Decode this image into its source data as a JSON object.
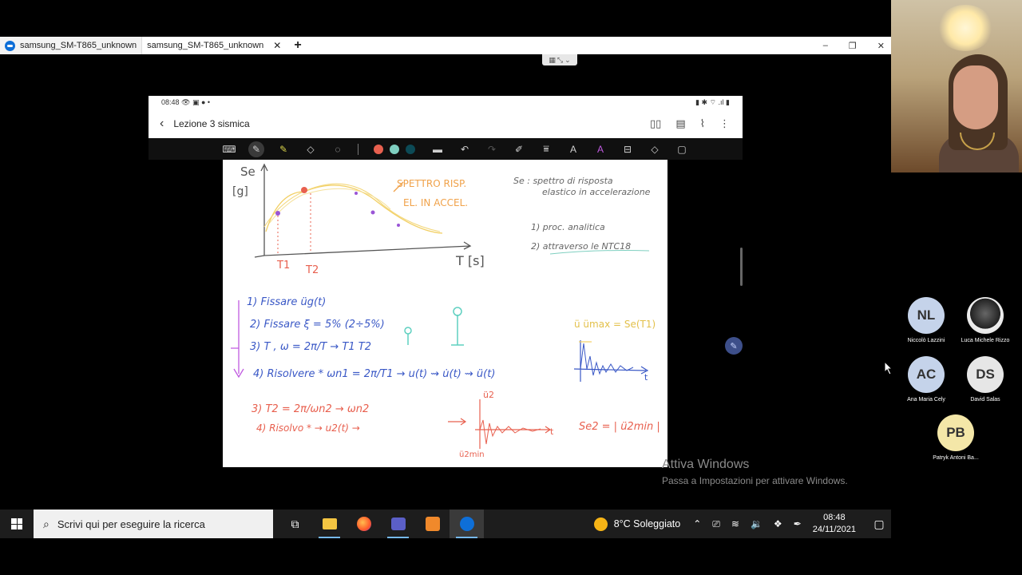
{
  "browser": {
    "tabs": [
      {
        "label": "samsung_SM-T865_unknown"
      },
      {
        "label": "samsung_SM-T865_unknown"
      }
    ],
    "new_tab": "+",
    "win_min": "–",
    "win_max": "❐",
    "win_close": "✕"
  },
  "tablet": {
    "status_time": "08:48",
    "status_icons": "👁 ▣ ● •",
    "status_right": "▮ ✱ ⌔ .ıl ▮",
    "note_title": "Lezione 3 sismica",
    "toolbar_colors": [
      "#e8604f",
      "#7fcfc0",
      "#0c4a56"
    ]
  },
  "notes": {
    "axis_y": "Se",
    "axis_y_unit": "[g]",
    "axis_x": "T [s]",
    "t1": "T1",
    "t2": "T2",
    "spectrum_label_1": "SPETTRO RISP.",
    "spectrum_label_2": "EL. IN ACCEL.",
    "se_def_1": "Se : spettro di risposta",
    "se_def_2": "elastico in accelerazione",
    "proc_1": "1) proc. analitica",
    "proc_2": "2) attraverso le NTC18",
    "step_1": "1) Fissare üg(t)",
    "step_2": "2) Fissare ξ = 5% (2÷5%)",
    "step_3": "3) T , ω = 2π/T  →  T1   T2",
    "step_4": "4) Risolvere *  ωn1 = 2π/T1  →  u(t) ⇝ u̇(t) ⇝ ü(t)",
    "graph_label": "ü   ümax = Se(T1)",
    "graph_t": "t",
    "step_3b": "3) T2 = 2π/ωn2  → ωn2",
    "step_4b": "4) Risolvo *  → u2(t)  →",
    "graph2_top": "ü2",
    "graph2_bottom": "ü2min",
    "graph2_t": "t",
    "se_result": "Se2 = | ü2min |"
  },
  "watermark": {
    "line1": "Attiva Windows",
    "line2": "Passa a Impostazioni per attivare Windows."
  },
  "participants": [
    {
      "initials": "NL",
      "name": "Niccolò Lazzini",
      "color": "#c5d3ea"
    },
    {
      "initials": "",
      "name": "Luca Michele Rizzo",
      "color": ""
    },
    {
      "initials": "AC",
      "name": "Ana Maria Cely",
      "color": "#c5d3ea"
    },
    {
      "initials": "DS",
      "name": "David Salas",
      "color": "#e6e6e6"
    },
    {
      "initials": "PB",
      "name": "Patryk Antoni Ba...",
      "color": "#f4e7a8"
    }
  ],
  "taskbar": {
    "search_placeholder": "Scrivi qui per eseguire la ricerca",
    "weather": "8°C  Soleggiato",
    "time": "08:48",
    "date": "24/11/2021"
  }
}
